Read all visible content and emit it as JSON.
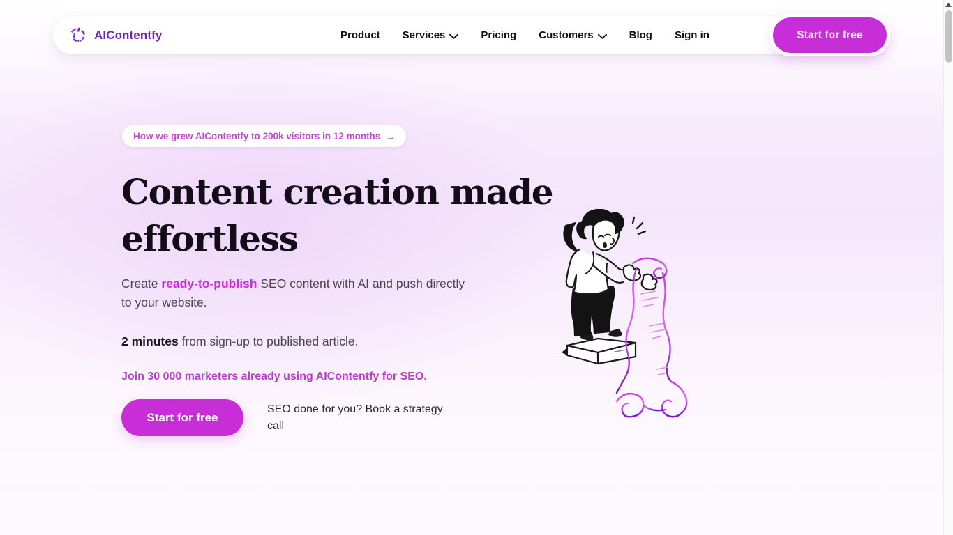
{
  "brand": {
    "name": "AIContentfy",
    "logo_icon": "circular-segments-logo-icon",
    "color": "#6d28b8"
  },
  "header": {
    "nav": [
      {
        "label": "Product",
        "has_dropdown": false,
        "icon": ""
      },
      {
        "label": "Services",
        "has_dropdown": true,
        "icon": "chevron-down-icon"
      },
      {
        "label": "Pricing",
        "has_dropdown": false,
        "icon": ""
      },
      {
        "label": "Customers",
        "has_dropdown": true,
        "icon": "chevron-down-icon"
      },
      {
        "label": "Blog",
        "has_dropdown": false,
        "icon": ""
      },
      {
        "label": "Sign in",
        "has_dropdown": false,
        "icon": ""
      }
    ],
    "cta_label": "Start for free",
    "cta_color": "#c82ed8"
  },
  "hero": {
    "badge": {
      "text": "How we grew AIContentfy to 200k visitors in 12 months",
      "arrow": "→",
      "icon": "arrow-right-icon",
      "color": "#c247d0"
    },
    "headline": "Content creation made effortless",
    "subheadline": {
      "before": "Create ",
      "highlight": "ready-to-publish",
      "after": " SEO content with AI and push directly to your website."
    },
    "speed_line": {
      "bold": "2 minutes",
      "rest": " from sign-up to published article."
    },
    "social_proof": "Join 30 000 marketers already using AIContentfy for SEO.",
    "cta_primary": "Start for free",
    "cta_secondary": "SEO done for you? Book a strategy call",
    "illustration": "woman-on-box-holding-long-scroll-illustration",
    "accent_color": "#c82ed8"
  },
  "scrollbar": {
    "up_arrow_icon": "scroll-up-arrow-icon",
    "thumb_icon": "scrollbar-thumb"
  }
}
